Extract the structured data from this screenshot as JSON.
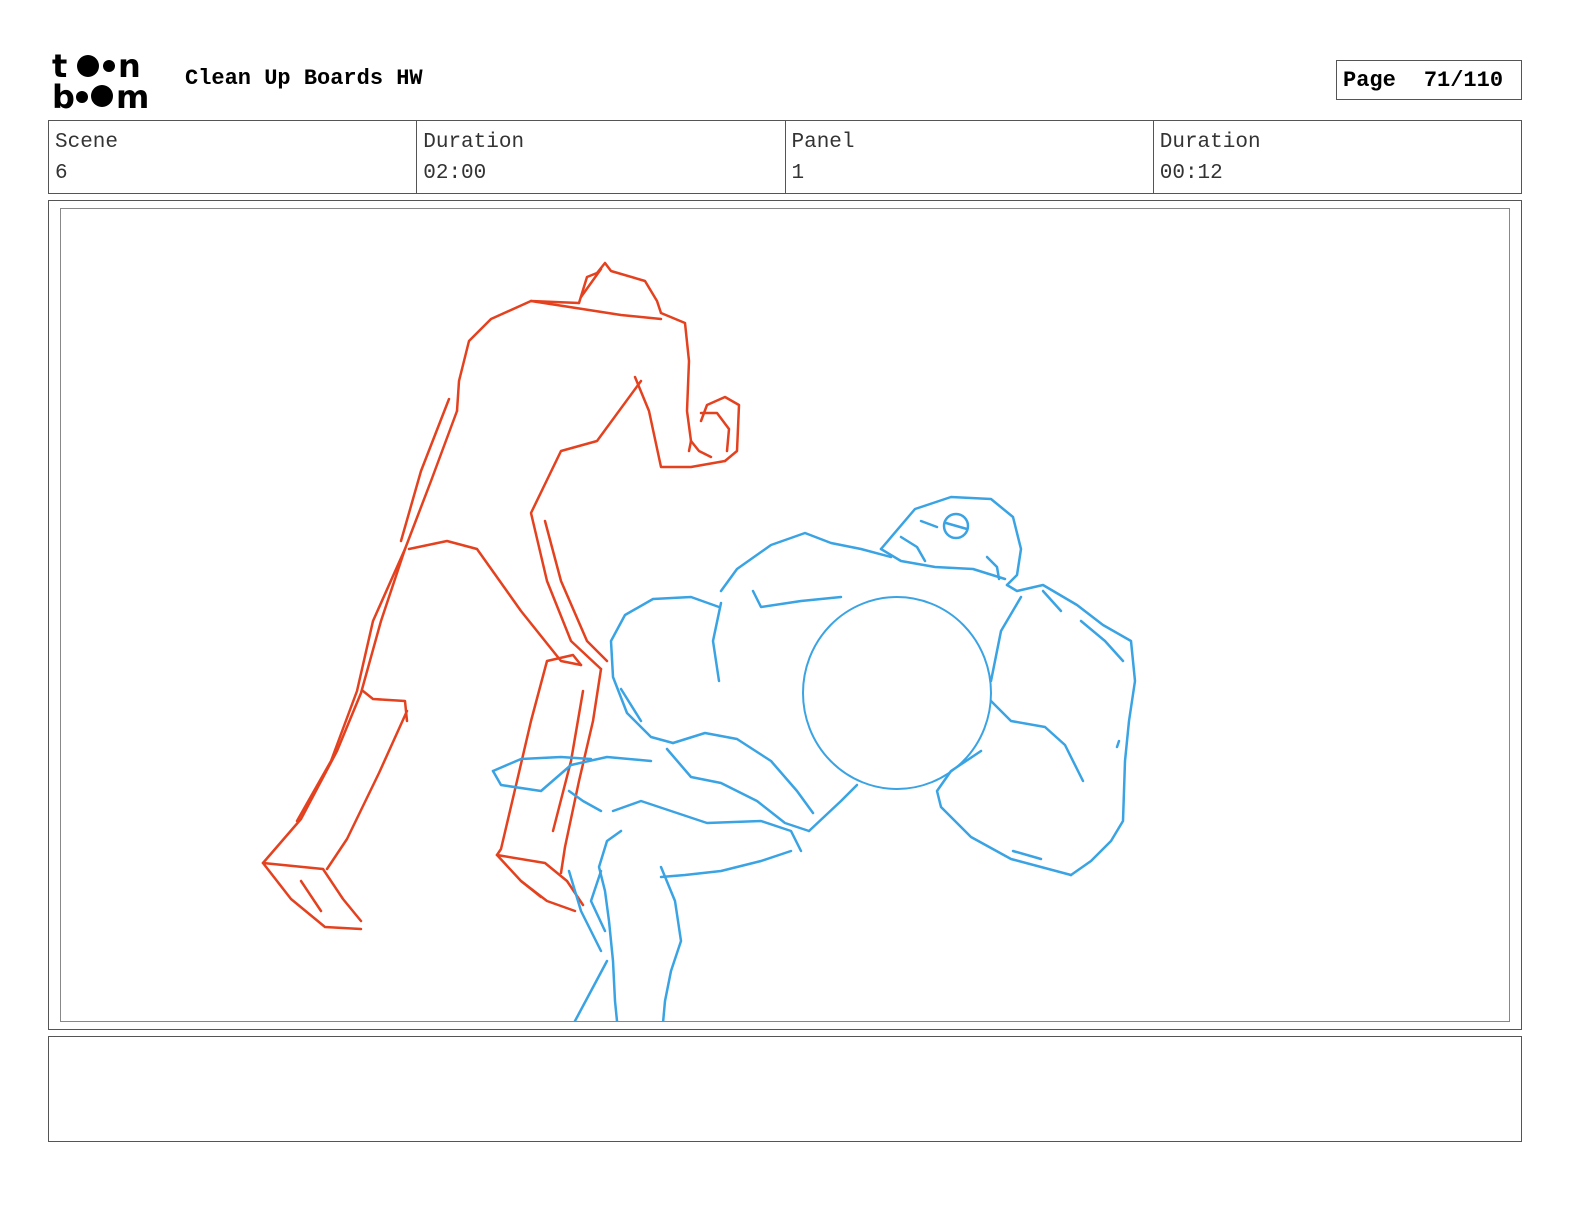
{
  "header": {
    "logo_alt": "toon boom",
    "title": "Clean Up Boards HW",
    "page_label": "Page",
    "page_number": "71/110"
  },
  "info": {
    "scene_label": "Scene",
    "scene_value": "6",
    "scene_duration_label": "Duration",
    "scene_duration_value": "02:00",
    "panel_label": "Panel",
    "panel_value": "1",
    "panel_duration_label": "Duration",
    "panel_duration_value": "00:12"
  },
  "sketch": {
    "red_color": "#e4411f",
    "blue_color": "#3aa3e3",
    "red_figure": "standing-figure-sketch",
    "blue_figure": "crouching-brute-sketch"
  },
  "notes": {
    "text": ""
  }
}
